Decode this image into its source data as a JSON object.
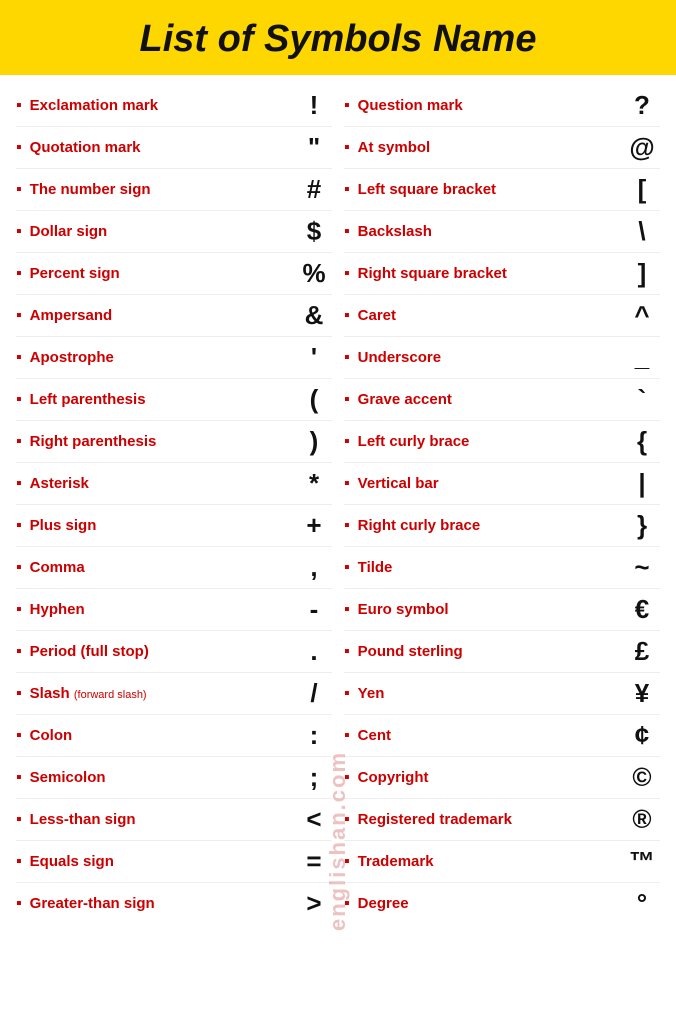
{
  "header": {
    "title": "List of Symbols Name"
  },
  "watermark": "englishan.com",
  "left_column": [
    {
      "name": "Exclamation mark",
      "char": "!",
      "small": ""
    },
    {
      "name": "Quotation mark",
      "char": "\"",
      "small": ""
    },
    {
      "name": "The number sign",
      "char": "#",
      "small": ""
    },
    {
      "name": "Dollar sign",
      "char": "$",
      "small": ""
    },
    {
      "name": "Percent sign",
      "char": "%",
      "small": ""
    },
    {
      "name": "Ampersand",
      "char": "&",
      "small": ""
    },
    {
      "name": "Apostrophe",
      "char": "'",
      "small": ""
    },
    {
      "name": "Left parenthesis",
      "char": "(",
      "small": ""
    },
    {
      "name": "Right parenthesis",
      "char": ")",
      "small": ""
    },
    {
      "name": "Asterisk",
      "char": "*",
      "small": ""
    },
    {
      "name": "Plus sign",
      "char": "+",
      "small": ""
    },
    {
      "name": "Comma",
      "char": ",",
      "small": ""
    },
    {
      "name": "Hyphen",
      "char": "-",
      "small": ""
    },
    {
      "name": "Period (full stop)",
      "char": ".",
      "small": ""
    },
    {
      "name": "Slash",
      "char": "/",
      "small": "forward slash"
    },
    {
      "name": "Colon",
      "char": ":",
      "small": ""
    },
    {
      "name": "Semicolon",
      "char": ";",
      "small": ""
    },
    {
      "name": "Less-than sign",
      "char": "<",
      "small": ""
    },
    {
      "name": "Equals sign",
      "char": "=",
      "small": ""
    },
    {
      "name": "Greater-than sign",
      "char": ">",
      "small": ""
    }
  ],
  "right_column": [
    {
      "name": "Question mark",
      "char": "?",
      "small": ""
    },
    {
      "name": "At symbol",
      "char": "@",
      "small": ""
    },
    {
      "name": "Left square bracket",
      "char": "[",
      "small": ""
    },
    {
      "name": "Backslash",
      "char": "\\",
      "small": ""
    },
    {
      "name": "Right square bracket",
      "char": "]",
      "small": ""
    },
    {
      "name": "Caret",
      "char": "^",
      "small": ""
    },
    {
      "name": "Underscore",
      "char": "_",
      "small": ""
    },
    {
      "name": "Grave accent",
      "char": "`",
      "small": ""
    },
    {
      "name": "Left curly brace",
      "char": "{",
      "small": ""
    },
    {
      "name": "Vertical bar",
      "char": "|",
      "small": ""
    },
    {
      "name": "Right curly brace",
      "char": "}",
      "small": ""
    },
    {
      "name": "Tilde",
      "char": "~",
      "small": ""
    },
    {
      "name": "Euro symbol",
      "char": "€",
      "small": ""
    },
    {
      "name": "Pound sterling",
      "char": "£",
      "small": ""
    },
    {
      "name": "Yen",
      "char": "¥",
      "small": ""
    },
    {
      "name": "Cent",
      "char": "¢",
      "small": ""
    },
    {
      "name": "Copyright",
      "char": "©",
      "small": ""
    },
    {
      "name": "Registered trademark",
      "char": "®",
      "small": ""
    },
    {
      "name": "Trademark",
      "char": "™",
      "small": ""
    },
    {
      "name": "Degree",
      "char": "°",
      "small": ""
    }
  ]
}
